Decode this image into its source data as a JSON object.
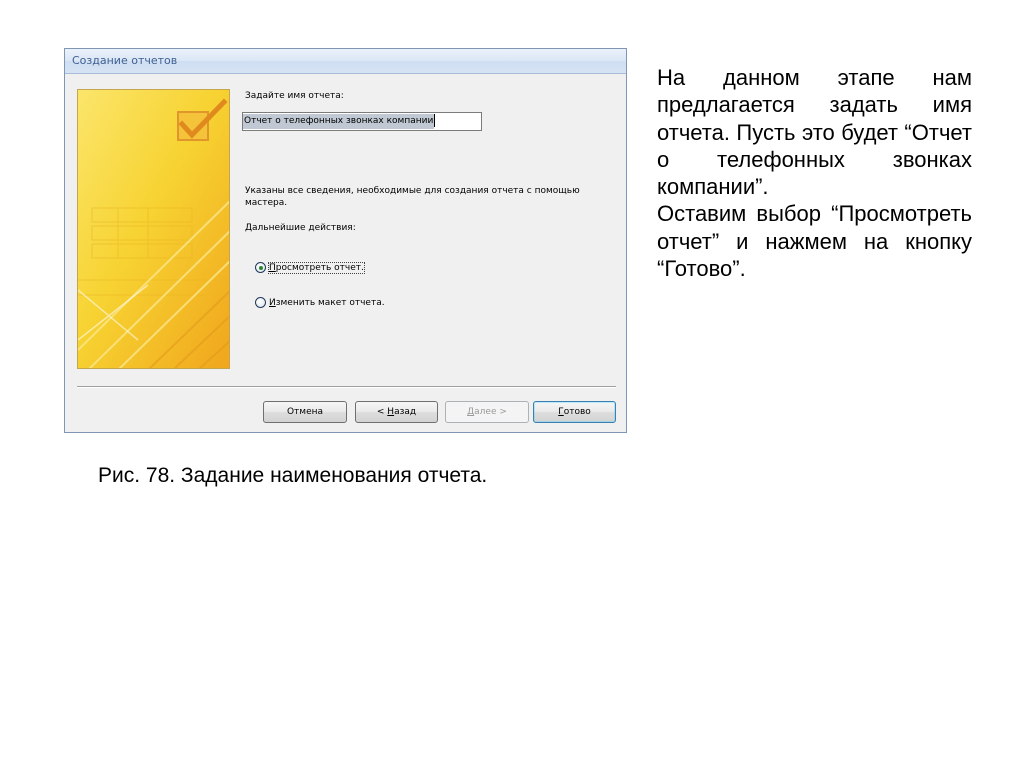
{
  "dialog": {
    "title": "Создание отчетов",
    "report_name_label": "Задайте имя отчета:",
    "report_name_value": "Отчет о телефонных звонках компании",
    "info_text": "Указаны все сведения, необходимые для создания отчета с помощью мастера.",
    "next_actions_label": "Дальнейшие действия:",
    "options": [
      {
        "accel": "П",
        "rest": "росмотреть отчет.",
        "checked": true
      },
      {
        "accel": "И",
        "rest": "зменить макет отчета.",
        "checked": false
      }
    ],
    "buttons": {
      "cancel": "Отмена",
      "back_prefix": "< ",
      "back_accel": "Н",
      "back_rest": "азад",
      "next_accel": "Д",
      "next_rest": "алее >",
      "finish_accel": "Г",
      "finish_rest": "отово"
    },
    "banner_icon": "checkbox-checked-icon",
    "colors": {
      "banner_yellow": "#f7d332",
      "banner_orange": "#f0a51c",
      "check_orange": "#e09a2a",
      "title_text": "#3e5f92",
      "radio_dot": "#2a8a2a"
    }
  },
  "side_text": {
    "paragraph1": "На данном этапе нам предлагается задать имя отчета. Пусть это будет “Отчет о телефонных звонках компании”.",
    "paragraph2": "Оставим выбор “Просмотреть отчет” и нажмем на кнопку “Готово”."
  },
  "caption": "Рис. 78. Задание наименования отчета."
}
